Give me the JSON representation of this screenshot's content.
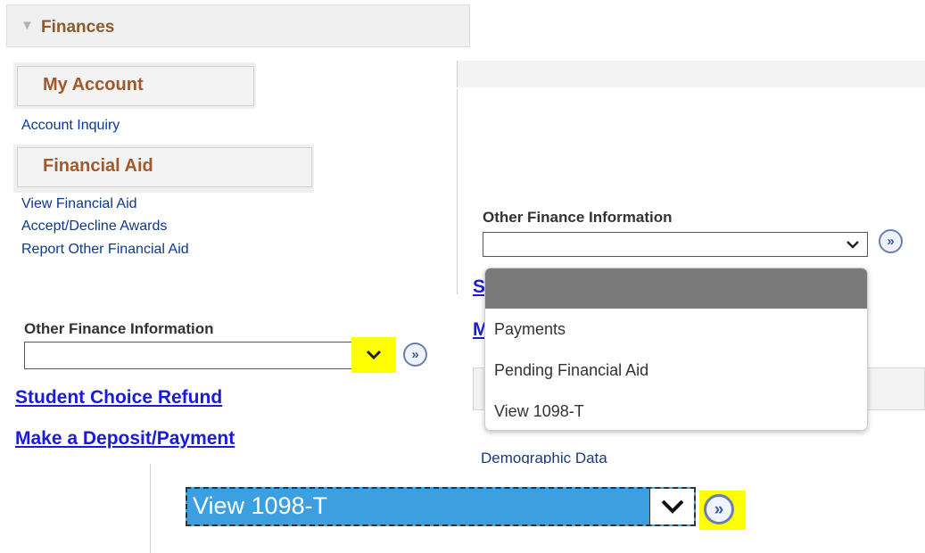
{
  "finances": {
    "title": "Finances",
    "my_account": {
      "heading": "My Account",
      "links": [
        "Account Inquiry"
      ]
    },
    "financial_aid": {
      "heading": "Financial Aid",
      "links": [
        "View Financial Aid",
        "Accept/Decline Awards",
        "Report Other Financial Aid"
      ]
    },
    "other_finance": {
      "label": "Other Finance Information",
      "selected": "",
      "go_glyph": "»"
    },
    "links": [
      "Student Choice Refund",
      "Make a Deposit/Payment"
    ]
  },
  "dropdown_open": {
    "label": "Other Finance Information",
    "partial_links": [
      "S",
      "M"
    ],
    "options": [
      "",
      "Payments",
      "Pending Financial Aid",
      "View 1098-T"
    ],
    "below_text": "Demographic Data",
    "go_glyph": "»"
  },
  "selected_view": {
    "value": "View 1098-T",
    "go_glyph": "»"
  },
  "highlight_color": "#ffff00",
  "icons": [
    "triangle-down-icon",
    "chevron-down-icon",
    "go-arrow-icon"
  ]
}
